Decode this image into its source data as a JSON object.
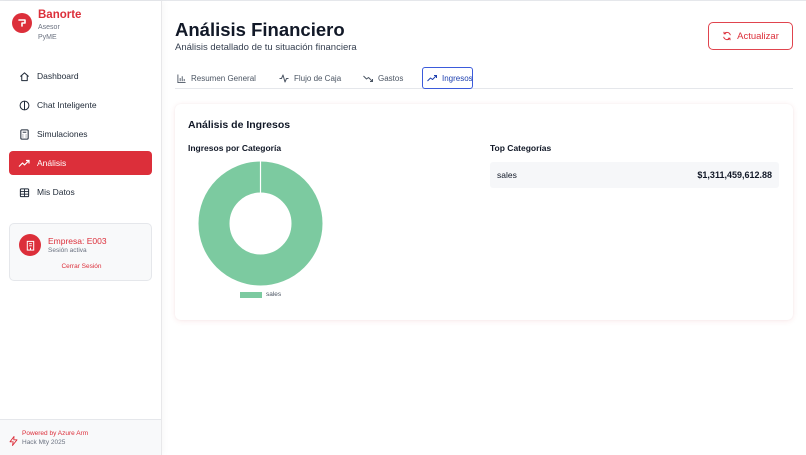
{
  "brand": {
    "name": "Banorte",
    "line1": "Asesor",
    "line2": "PyME"
  },
  "nav": {
    "items": [
      {
        "label": "Dashboard",
        "icon": "home-icon"
      },
      {
        "label": "Chat Inteligente",
        "icon": "brain-icon"
      },
      {
        "label": "Simulaciones",
        "icon": "calculator-icon"
      },
      {
        "label": "Análisis",
        "icon": "trending-up-icon",
        "active": true
      },
      {
        "label": "Mis Datos",
        "icon": "database-icon"
      }
    ]
  },
  "company": {
    "name": "Empresa: E003",
    "status": "Sesión activa",
    "logout": "Cerrar Sesión"
  },
  "footer": {
    "line1": "Powered by Azure Arm",
    "line2": "Hack Mty 2025"
  },
  "header": {
    "title": "Análisis Financiero",
    "subtitle": "Análisis detallado de tu situación financiera",
    "refresh_label": "Actualizar"
  },
  "tabs": [
    {
      "label": "Resumen General",
      "icon": "bar-chart-icon"
    },
    {
      "label": "Flujo de Caja",
      "icon": "activity-icon"
    },
    {
      "label": "Gastos",
      "icon": "trending-down-icon"
    },
    {
      "label": "Ingresos",
      "icon": "trending-up-icon",
      "active": true
    }
  ],
  "card": {
    "title": "Análisis de Ingresos",
    "chart_title": "Ingresos por Categoría",
    "top_title": "Top Categorías",
    "top_categories": [
      {
        "name": "sales",
        "value": "$1,311,459,612.88"
      }
    ]
  },
  "colors": {
    "brand": "#dc2f3a",
    "accent_tab": "#3b5bdb",
    "series": "#7ccaa0"
  },
  "chart_data": {
    "type": "pie",
    "title": "Ingresos por Categoría",
    "categories": [
      "sales"
    ],
    "values": [
      100
    ],
    "legend": "bottom",
    "donut": true
  }
}
